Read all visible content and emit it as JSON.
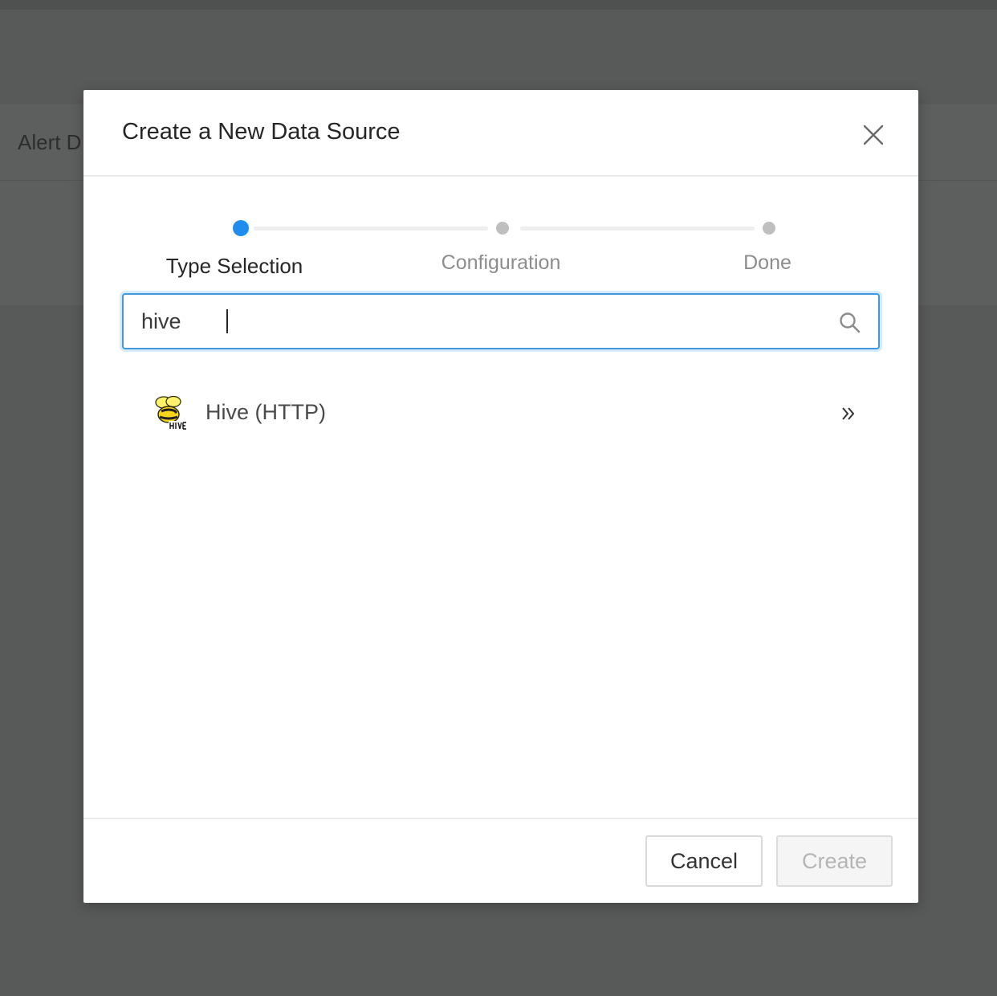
{
  "background": {
    "tab_label": "Alert D"
  },
  "modal": {
    "title": "Create a New Data Source",
    "close_icon": "close-icon",
    "steps": [
      {
        "label": "Type Selection",
        "state": "active"
      },
      {
        "label": "Configuration",
        "state": "pending"
      },
      {
        "label": "Done",
        "state": "pending"
      }
    ],
    "search": {
      "value": "hive",
      "icon": "search-icon"
    },
    "results": [
      {
        "label": "Hive (HTTP)",
        "icon": "hive-logo-icon",
        "action_icon": "double-chevron-right-icon"
      }
    ],
    "footer": {
      "cancel_label": "Cancel",
      "create_label": "Create"
    }
  },
  "colors": {
    "accent": "#1f8ded",
    "overlay": "#585a59",
    "step_inactive": "#bfbfbf",
    "disabled_text": "#b5b5b5"
  }
}
